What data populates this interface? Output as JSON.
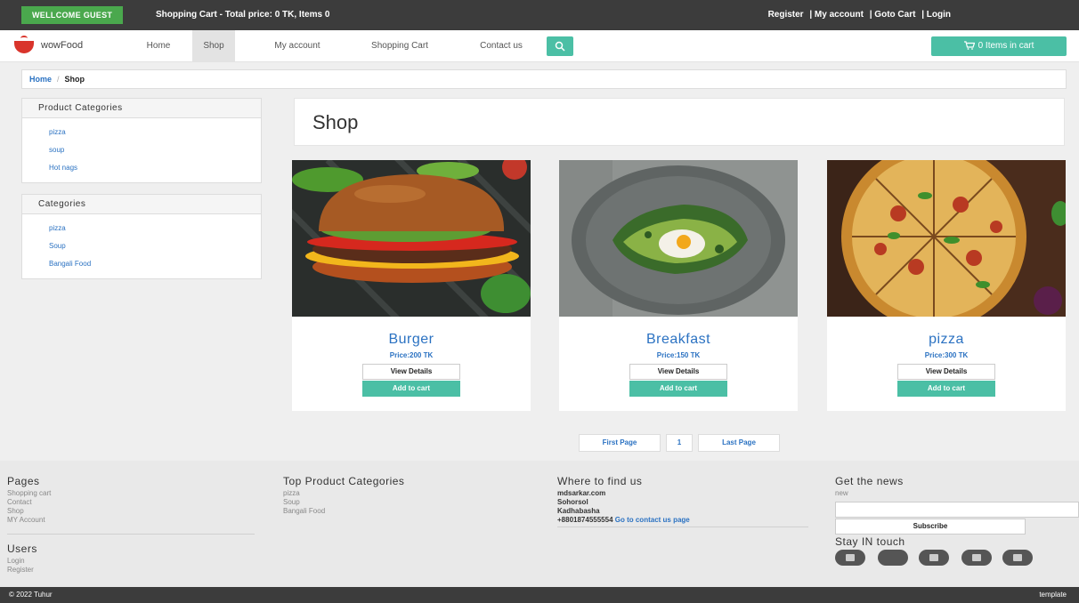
{
  "topbar": {
    "welcome": "WELLCOME GUEST",
    "cart_summary": "Shopping Cart - Total price: 0 TK, Items 0",
    "links": [
      "Register",
      "| My account",
      "| Goto Cart",
      "| Login"
    ]
  },
  "brand": {
    "name": "wowFood"
  },
  "nav": {
    "items": [
      "Home",
      "Shop",
      "My account",
      "Shopping Cart",
      "Contact us"
    ],
    "active": "Shop",
    "cart_button": "0 Items in cart"
  },
  "breadcrumb": {
    "home": "Home",
    "separator": "/",
    "current": "Shop"
  },
  "sidebar": {
    "product_categories": {
      "title": "Product Categories",
      "items": [
        "pizza",
        "soup",
        "Hot nags"
      ]
    },
    "categories": {
      "title": "Categories",
      "items": [
        "pizza",
        "Soup",
        "Bangali Food"
      ]
    }
  },
  "shop": {
    "title": "Shop",
    "products": [
      {
        "name": "Burger",
        "price": "Price:200 TK",
        "view": "View Details",
        "add": "Add to cart"
      },
      {
        "name": "Breakfast",
        "price": "Price:150 TK",
        "view": "View Details",
        "add": "Add to cart"
      },
      {
        "name": "pizza",
        "price": "Price:300 TK",
        "view": "View Details",
        "add": "Add to cart"
      }
    ]
  },
  "pagination": {
    "first": "First Page",
    "page": "1",
    "last": "Last Page"
  },
  "footer": {
    "pages": {
      "title": "Pages",
      "items": [
        "Shopping cart",
        "Contact",
        "Shop",
        "MY Account"
      ]
    },
    "users": {
      "title": "Users",
      "items": [
        "Login",
        "Register"
      ]
    },
    "top_categories": {
      "title": "Top Product Categories",
      "items": [
        "pizza",
        "Soup",
        "Bangali Food"
      ]
    },
    "where": {
      "title": "Where to find us",
      "lines": [
        "mdsarkar.com",
        "Sohorsol",
        "Kadhabasha",
        "+8801874555554"
      ],
      "link": "Go to contact us page"
    },
    "news": {
      "title": "Get the news",
      "text": "new",
      "subscribe": "Subscribe"
    },
    "social_title": "Stay IN touch",
    "copyright": "© 2022 Tuhur",
    "credit": "template"
  },
  "colors": {
    "accent": "#4bbfa5",
    "link": "#2b72c2",
    "dark": "#3c3c3c",
    "welcome": "#4aa84d"
  }
}
